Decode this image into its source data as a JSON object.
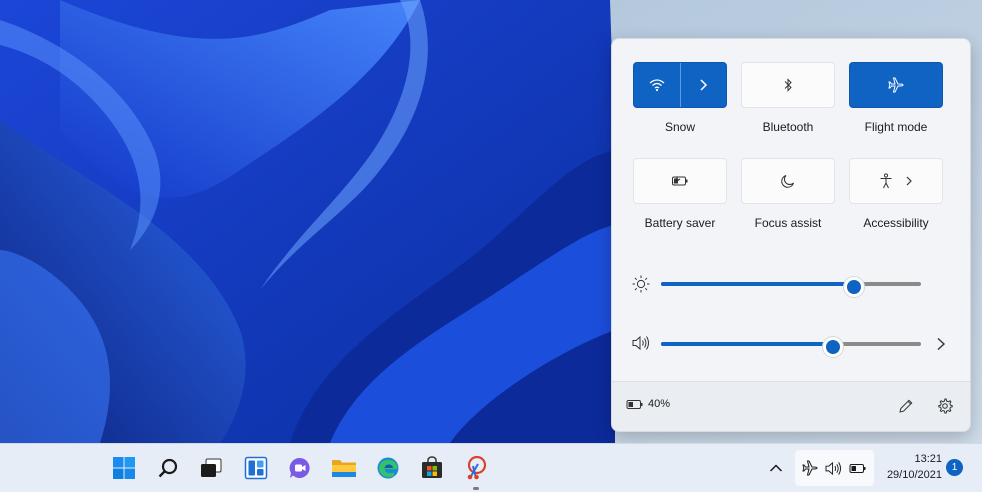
{
  "quick_settings": {
    "tiles": [
      {
        "label": "Snow",
        "icon": "wifi-icon",
        "state": "on",
        "has_arrow": true
      },
      {
        "label": "Bluetooth",
        "icon": "bluetooth-icon",
        "state": "off"
      },
      {
        "label": "Flight mode",
        "icon": "airplane-icon",
        "state": "on"
      },
      {
        "label": "Battery saver",
        "icon": "battery-saver-icon",
        "state": "off"
      },
      {
        "label": "Focus assist",
        "icon": "moon-icon",
        "state": "off"
      },
      {
        "label": "Accessibility",
        "icon": "accessibility-icon",
        "state": "off",
        "has_arrow": true
      }
    ],
    "brightness": {
      "icon": "sun-icon",
      "level_percent": 73
    },
    "volume": {
      "icon": "speaker-icon",
      "level_percent": 65
    },
    "footer": {
      "battery_text": "40%",
      "edit_icon": "pencil-icon",
      "settings_icon": "gear-icon"
    }
  },
  "taskbar": {
    "pinned": [
      "start-icon",
      "search-icon",
      "task-view-icon",
      "widgets-icon",
      "chat-icon",
      "file-explorer-icon",
      "edge-icon",
      "store-icon",
      "snipping-tool-icon"
    ],
    "tray": [
      "chevron-up-icon",
      "airplane-icon",
      "speaker-icon",
      "battery-icon"
    ],
    "clock": {
      "time": "13:21",
      "date": "29/10/2021"
    },
    "notification_count": "1"
  },
  "colors": {
    "accent": "#0f63c3",
    "panel": "#f2f4f8",
    "taskbar": "#e7edf6"
  }
}
